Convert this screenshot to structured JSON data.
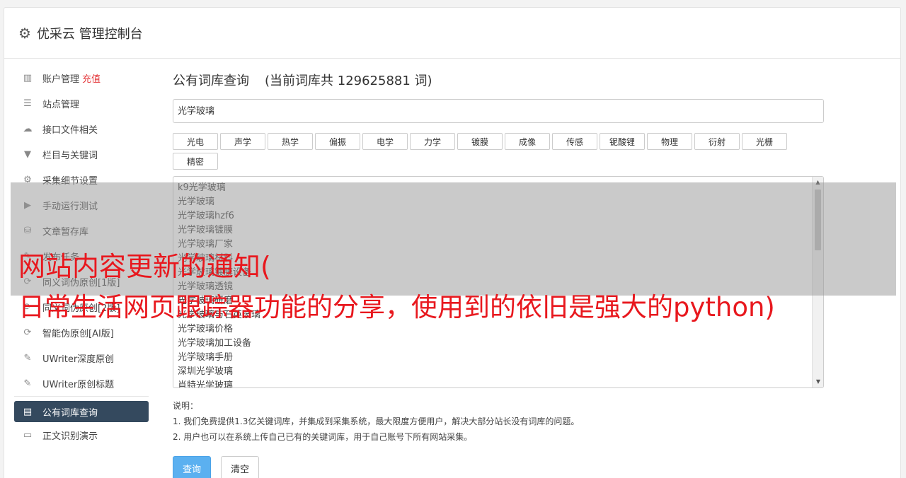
{
  "header": {
    "title": "优采云 管理控制台",
    "icon": "gear-icon"
  },
  "sidebar": {
    "items": [
      {
        "icon": "bar-chart-icon",
        "glyph": "▥",
        "label": "账户管理",
        "highlight": "充值"
      },
      {
        "icon": "server-icon",
        "glyph": "☰",
        "label": "站点管理"
      },
      {
        "icon": "cloud-upload-icon",
        "glyph": "☁",
        "label": "接口文件相关"
      },
      {
        "icon": "filter-icon",
        "glyph": "▼",
        "label": "栏目与关键词"
      },
      {
        "icon": "cogs-icon",
        "glyph": "⚙",
        "label": "采集细节设置"
      },
      {
        "icon": "play-circle-icon",
        "glyph": "▶",
        "label": "手动运行测试"
      },
      {
        "icon": "database-icon",
        "glyph": "⛁",
        "label": "文章暂存库"
      },
      {
        "icon": "task-icon",
        "glyph": "✎",
        "label": "发布任务"
      },
      {
        "icon": "refresh-icon",
        "glyph": "⟳",
        "label": "同义词伪原创[1版]"
      },
      {
        "icon": "refresh-icon",
        "glyph": "⟳",
        "label": "同义词伪原创[2版]"
      },
      {
        "icon": "refresh-icon",
        "glyph": "⟳",
        "label": "智能伪原创[AI版]"
      },
      {
        "icon": "edit-icon",
        "glyph": "✎",
        "label": "UWriter深度原创"
      },
      {
        "icon": "edit-icon",
        "glyph": "✎",
        "label": "UWriter原创标题"
      },
      {
        "icon": "book-icon",
        "glyph": "▤",
        "label": "公有词库查询",
        "active": true
      },
      {
        "icon": "monitor-icon",
        "glyph": "▭",
        "label": "正文识别演示"
      }
    ]
  },
  "main": {
    "title": "公有词库查询",
    "count_text": "(当前词库共 129625881 词)",
    "search_value": "光学玻璃",
    "tags": [
      "光电",
      "声学",
      "热学",
      "偏振",
      "电学",
      "力学",
      "镀膜",
      "成像",
      "传感",
      "铌酸锂",
      "物理",
      "衍射",
      "光栅",
      "精密"
    ],
    "results": [
      "k9光学玻璃",
      "光学玻璃",
      "光学玻璃hzf6",
      "光学玻璃镀膜",
      "光学玻璃厂家",
      "光学玻璃材料",
      "光学玻璃镀膜设备",
      "光学玻璃透镜",
      "光学玻璃研磨",
      "光学玻璃与石英玻璃",
      "光学玻璃价格",
      "光学玻璃加工设备",
      "光学玻璃手册",
      "深圳光学玻璃",
      "肖特光学玻璃"
    ],
    "notes": {
      "label": "说明：",
      "lines": [
        "1. 我们免费提供1.3亿关键词库，并集成到采集系统，最大限度方便用户，解决大部分站长没有词库的问题。",
        "2. 用户也可以在系统上传自己已有的关键词库，用于自己账号下所有网站采集。"
      ]
    },
    "buttons": {
      "query": "查询",
      "clear": "清空"
    }
  },
  "overlay": {
    "line1": "网站内容更新的通知(",
    "line2": "日常生活网页跟踪器功能的分享，使用到的依旧是强大的python)"
  },
  "colors": {
    "accent": "#5bb0f0",
    "active_nav": "#34495e",
    "headline": "#e8181e",
    "highlight": "#e4393c"
  }
}
